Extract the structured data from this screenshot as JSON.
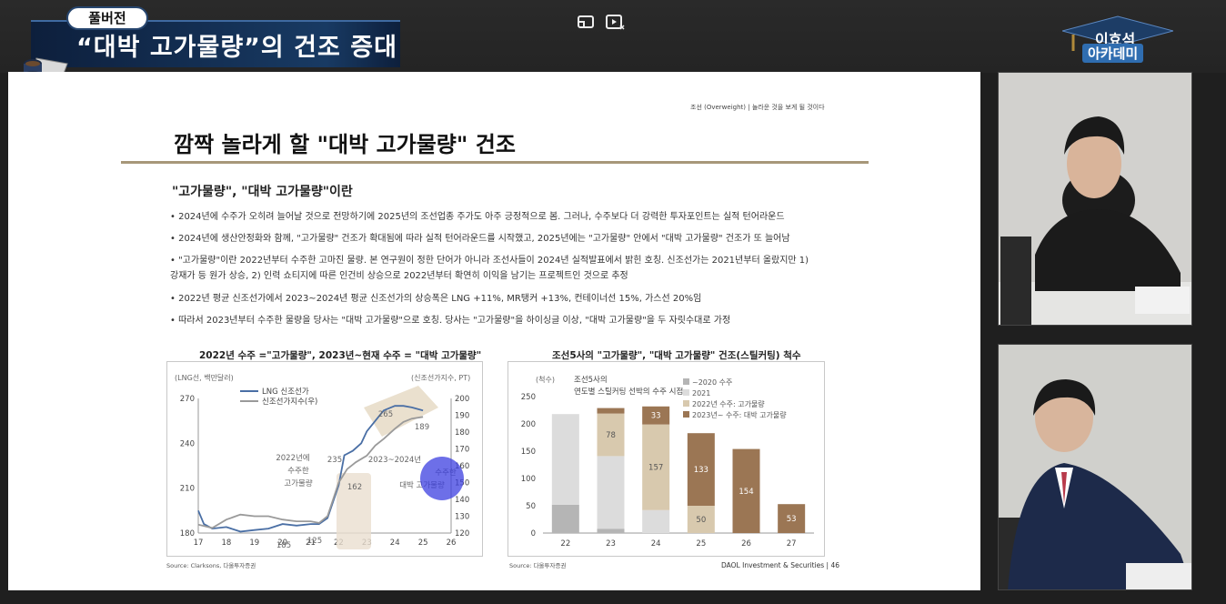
{
  "overlay": {
    "badge": "풀버전",
    "title": "“대박 고가물량”의 건조 증대",
    "academy_line1": "이효석",
    "academy_line2": "아카데미"
  },
  "slide": {
    "header_right": "조선 (Overweight)  |  놀라운 것을 보게 될 것이다",
    "title": "깜짝 놀라게 할 \"대박 고가물량\" 건조",
    "subhead": "\"고가물량\", \"대박 고가물량\"이란",
    "bullets": [
      "• 2024년에 수주가 오히려 늘어날 것으로 전망하기에 2025년의 조선업종 주가도 아주 긍정적으로 봄. 그러나, 수주보다 더 강력한 투자포인트는 실적 턴어라운드",
      "• 2024년에 생산안정화와 함께, \"고가물량\" 건조가 확대됨에 따라 실적 턴어라운드를 시작했고, 2025년에는 \"고가물량\" 안에서 \"대박 고가물량\" 건조가 또 늘어남",
      "• \"고가물량\"이란 2022년부터 수주한 고마진 물량. 본 연구원이 정한 단어가 아니라 조선사들이 2024년 실적발표에서 밝힌 호칭. 신조선가는 2021년부터 올랐지만 1)",
      "   강재가 등 원가 상승, 2) 인력 쇼티지에 따른 인건비 상승으로 2022년부터 확연히 이익을 남기는 프로젝트인 것으로 추정",
      "• 2022년 평균 신조선가에서 2023~2024년 평균 신조선가의 상승폭은 LNG +11%, MR탱커 +13%, 컨테이너선 15%, 가스선 20%임",
      "• 따라서 2023년부터 수주한 물량을 당사는 \"대박 고가물량\"으로 호칭. 당사는 \"고가물량\"을 하이싱글 이상, \"대박 고가물량\"을 두 자릿수대로 가정"
    ],
    "footer": "DAOL Investment & Securities  |  46"
  },
  "chart_data": [
    {
      "type": "line",
      "title": "2022년 수주 =\"고가물량\", 2023년~현재 수주 = \"대박 고가물량\"",
      "ylabel_left": "(LNG선, 백만달러)",
      "ylabel_right": "(신조선가지수, PT)",
      "x_ticks": [
        "17",
        "18",
        "19",
        "20",
        "21",
        "22",
        "23",
        "24",
        "25",
        "26"
      ],
      "y_left_ticks": [
        "270",
        "240",
        "210",
        "180"
      ],
      "y_right_ticks": [
        "200",
        "190",
        "180",
        "170",
        "160",
        "150",
        "140",
        "130",
        "120"
      ],
      "ylim_left": [
        180,
        270
      ],
      "ylim_right": [
        120,
        200
      ],
      "series": [
        {
          "name": "LNG 신조선가",
          "axis": "left",
          "color": "#4a6fa5",
          "x": [
            17.0,
            17.2,
            17.5,
            18.0,
            18.5,
            19.0,
            19.5,
            20.0,
            20.5,
            21.0,
            21.3,
            21.6,
            22.0,
            22.2,
            22.5,
            22.8,
            23.0,
            23.3,
            23.6,
            24.0,
            24.3,
            24.6,
            25.0
          ],
          "y": [
            195,
            186,
            183,
            184,
            181,
            182,
            183,
            186,
            185,
            186,
            186,
            190,
            212,
            232,
            235,
            240,
            248,
            255,
            262,
            265,
            265,
            264,
            262
          ]
        },
        {
          "name": "신조선가지수(우)",
          "axis": "right",
          "color": "#9a9a9a",
          "x": [
            17.0,
            17.5,
            18.0,
            18.5,
            19.0,
            19.5,
            20.0,
            20.5,
            21.0,
            21.3,
            21.6,
            22.0,
            22.3,
            22.6,
            23.0,
            23.3,
            23.6,
            24.0,
            24.3,
            24.6,
            25.0
          ],
          "y": [
            125,
            123,
            128,
            131,
            130,
            130,
            128,
            127,
            127,
            126,
            130,
            150,
            158,
            162,
            166,
            172,
            176,
            182,
            186,
            188,
            189
          ]
        }
      ],
      "annotations": [
        "265",
        "189",
        "235",
        "162",
        "185",
        "125",
        "2022년에",
        "수주한",
        "고가물량",
        "2023~2024년",
        "수주한",
        "대박 고가물량"
      ],
      "source": "Source: Clarksons, 다올투자증권"
    },
    {
      "type": "bar",
      "stacked": true,
      "title": "조선5사의 \"고가물량\", \"대박 고가물량\" 건조(스틸커팅) 척수",
      "ylabel": "(척수)",
      "inner_title": [
        "조선5사의",
        "연도별 스틸커팅 선박의 수주 시점"
      ],
      "categories": [
        "22",
        "23",
        "24",
        "25",
        "26",
        "27"
      ],
      "y_ticks": [
        "250",
        "200",
        "150",
        "100",
        "50",
        "0"
      ],
      "ylim": [
        0,
        250
      ],
      "series": [
        {
          "name": "~2020 수주",
          "color": "#b5b5b5",
          "values": [
            52,
            8,
            0,
            0,
            0,
            0
          ]
        },
        {
          "name": "2021",
          "color": "#dcdcdc",
          "values": [
            166,
            133,
            42,
            0,
            0,
            0
          ]
        },
        {
          "name": "2022년 수주: 고가물량",
          "color": "#d8c9ae",
          "values": [
            0,
            78,
            157,
            50,
            0,
            0
          ]
        },
        {
          "name": "2023년~ 수주: 대박 고가물량",
          "color": "#9b7654",
          "values": [
            0,
            10,
            33,
            133,
            154,
            53
          ]
        }
      ],
      "data_labels": [
        "78",
        "33",
        "157",
        "133",
        "50",
        "154",
        "53"
      ],
      "source": "Source: 다올투자증권"
    }
  ]
}
